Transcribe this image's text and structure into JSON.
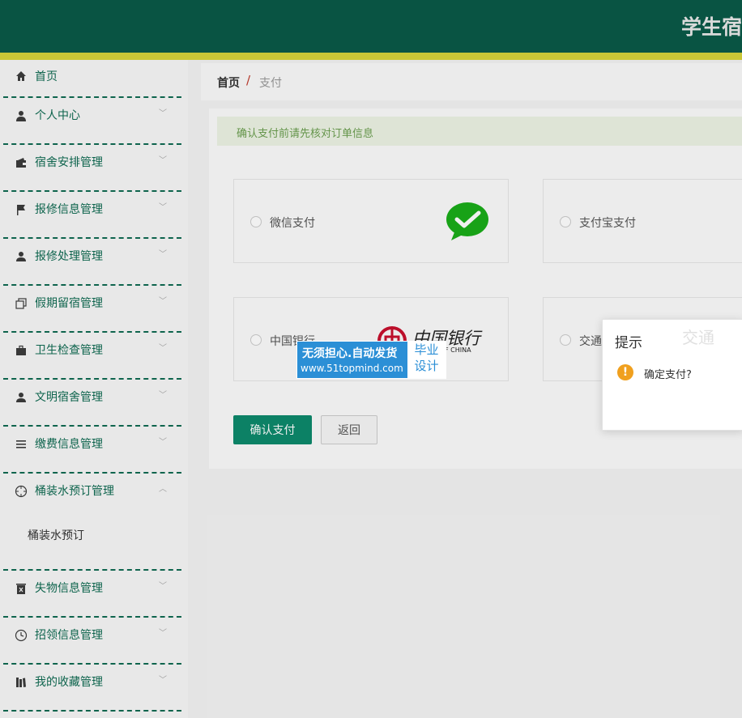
{
  "header": {
    "title": "学生宿"
  },
  "sidebar": {
    "items": [
      {
        "label": "首页",
        "icon": "home-icon"
      },
      {
        "label": "个人中心",
        "icon": "person-icon"
      },
      {
        "label": "宿舍安排管理",
        "icon": "wallet-icon"
      },
      {
        "label": "报修信息管理",
        "icon": "flag-icon"
      },
      {
        "label": "报修处理管理",
        "icon": "user-icon"
      },
      {
        "label": "假期留宿管理",
        "icon": "copy-icon"
      },
      {
        "label": "卫生检查管理",
        "icon": "briefcase-icon"
      },
      {
        "label": "文明宿舍管理",
        "icon": "user-plus-icon"
      },
      {
        "label": "缴费信息管理",
        "icon": "list-icon"
      },
      {
        "label": "桶装水预订管理",
        "icon": "target-icon"
      },
      {
        "label": "失物信息管理",
        "icon": "trash-icon"
      },
      {
        "label": "招领信息管理",
        "icon": "clock-icon"
      },
      {
        "label": "我的收藏管理",
        "icon": "books-icon"
      }
    ],
    "subitem": {
      "label": "桶装水预订"
    }
  },
  "breadcrumb": {
    "home": "首页",
    "separator": "/",
    "current": "支付"
  },
  "notice": "确认支付前请先核对订单信息",
  "payments": [
    {
      "label": "微信支付"
    },
    {
      "label": "支付宝支付"
    },
    {
      "label": "中国银行"
    },
    {
      "label": "交通"
    }
  ],
  "bank_logo": {
    "text": "中国银行",
    "sub": "F CHINA"
  },
  "buttons": {
    "confirm": "确认支付",
    "back": "返回"
  },
  "dialog": {
    "title": "提示",
    "message": "确定支付?",
    "icon": "!",
    "watermark": "交通"
  },
  "watermark": {
    "line1": "无须担心.自动发货",
    "line2": "www.51topmind.com",
    "right1": "毕业",
    "right2": "设计"
  },
  "colors": {
    "header": "#0a5a48",
    "accent_strip": "#d6d33a",
    "primary": "#0d8a6c",
    "menu_text": "#0f6b52"
  }
}
